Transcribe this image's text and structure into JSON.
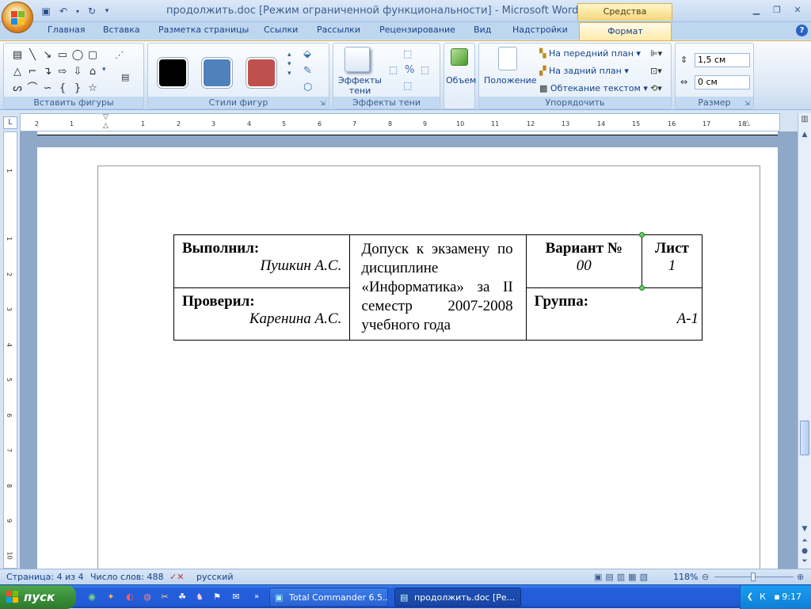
{
  "window": {
    "title": "продолжить.doc [Режим ограниченной функциональности] - Microsoft Word",
    "context_tab_title": "Средства рисования",
    "controls": [
      "minimize",
      "restore",
      "close"
    ]
  },
  "ribbon_tabs": [
    "Главная",
    "Вставка",
    "Разметка страницы",
    "Ссылки",
    "Рассылки",
    "Рецензирование",
    "Вид",
    "Надстройки"
  ],
  "active_tab": "Формат",
  "ribbon": {
    "groups": {
      "insert_shapes": "Вставить фигуры",
      "shape_styles": "Стили фигур",
      "shadow_effects": "Эффекты тени",
      "arrange": "Упорядочить",
      "size": "Размер"
    },
    "shadow_button": "Эффекты\nтени",
    "volume_button": "Объем",
    "position_button": "Положение",
    "bring_front": "На передний план",
    "send_back": "На задний план",
    "text_wrap": "Обтекание текстом",
    "height_value": "1,5 см",
    "width_value": "0 см",
    "style_colors": [
      "#000000",
      "#4f81bd",
      "#c0504d"
    ]
  },
  "ruler_h_labels": [
    "2",
    "1",
    "1",
    "2",
    "3",
    "4",
    "5",
    "6",
    "7",
    "8",
    "9",
    "10",
    "11",
    "12",
    "13",
    "14",
    "15",
    "16",
    "17",
    "18"
  ],
  "ruler_v_labels": [
    "1",
    "1",
    "2",
    "3",
    "4",
    "5",
    "6",
    "7",
    "8",
    "9",
    "10"
  ],
  "stamp": {
    "performed_label": "Выполнил:",
    "performed_name": "Пушкин А.С.",
    "admission_text": "Допуск к экзамену по дисциплине «Информатика» за II семестр 2007-2008 учебного года",
    "variant_label": "Вариант №",
    "variant_value": "00",
    "sheet_label": "Лист",
    "sheet_value": "1",
    "checked_label": "Проверил:",
    "checked_name": "Каренина А.С.",
    "group_label": "Группа:",
    "group_value": "А-1"
  },
  "status": {
    "page": "Страница: 4 из 4",
    "words": "Число слов: 488",
    "language": "русский",
    "zoom": "118%"
  },
  "taskbar": {
    "start": "пуск",
    "tasks": [
      "Total Commander 6.5...",
      "продолжить.doc [Ре..."
    ],
    "clock": "9:17"
  }
}
